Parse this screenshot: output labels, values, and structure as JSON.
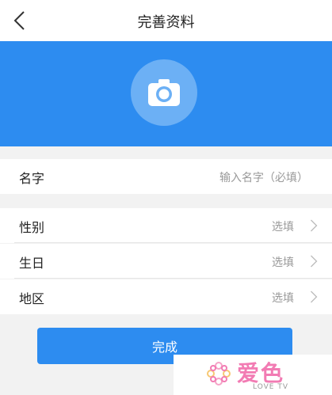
{
  "header": {
    "title": "完善资料",
    "back_icon": "chevron-left-icon"
  },
  "avatar": {
    "icon": "camera-icon",
    "banner_color": "#2d8cf0"
  },
  "form": {
    "name": {
      "label": "名字",
      "placeholder": "输入名字（必填）"
    },
    "gender": {
      "label": "性别",
      "value": "选填",
      "icon": "chevron-right-icon"
    },
    "birthday": {
      "label": "生日",
      "value": "选填",
      "icon": "chevron-right-icon"
    },
    "region": {
      "label": "地区",
      "value": "选填",
      "icon": "chevron-right-icon"
    }
  },
  "submit": {
    "label": "完成",
    "color": "#2d8cf0"
  },
  "watermark": {
    "logo": "爱色",
    "tagline": "LOVE TV",
    "icon": "flower-icon",
    "color": "#f27bb3"
  }
}
